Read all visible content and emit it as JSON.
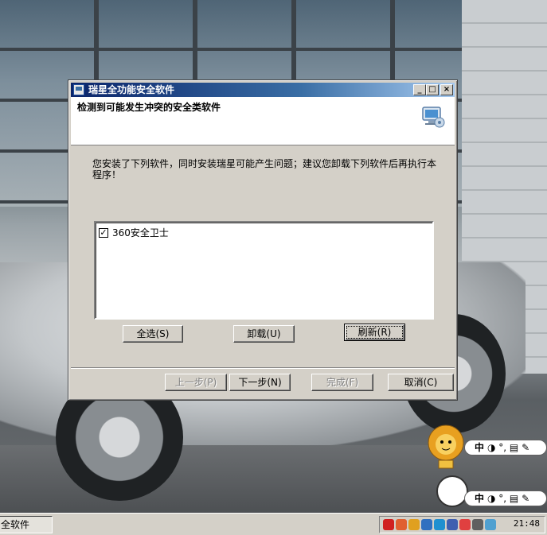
{
  "window": {
    "title": "瑞星全功能安全软件",
    "controls": {
      "minimize": "_",
      "maximize": "□",
      "close": "×"
    },
    "header_title": "检测到可能发生冲突的安全类软件",
    "description": "您安装了下列软件，同时安装瑞星可能产生问题；建议您卸载下列软件后再执行本程序！",
    "list": {
      "items": [
        {
          "label": "360安全卫士",
          "checked": true
        }
      ]
    },
    "buttons": {
      "select_all": "全选(S)",
      "uninstall": "卸载(U)",
      "refresh": "刷新(R)",
      "back": "上一步(P)",
      "next": "下一步(N)",
      "finish": "完成(F)",
      "cancel": "取消(C)"
    }
  },
  "taskbar": {
    "task_button": "全软件",
    "clock": "21:48"
  },
  "ime": {
    "mode": "中",
    "symbols": "◑ °, ▤ ✎"
  }
}
